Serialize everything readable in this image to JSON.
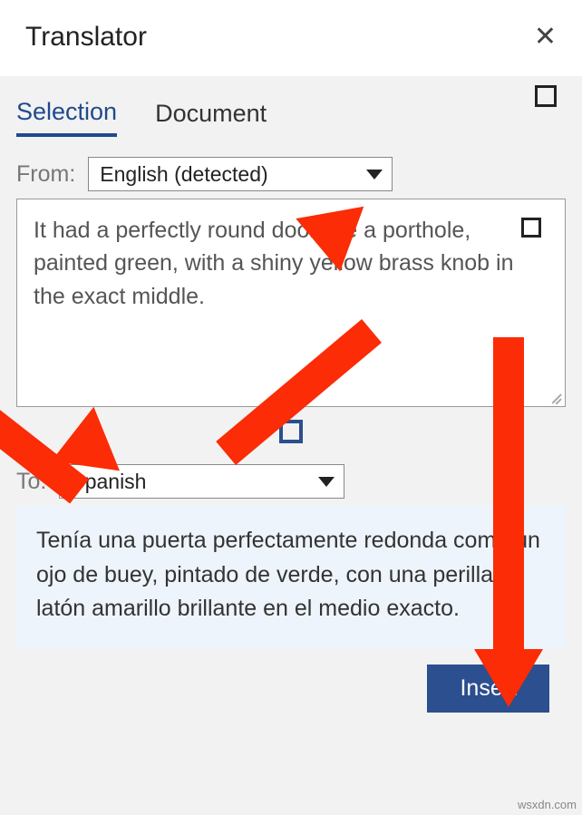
{
  "header": {
    "title": "Translator"
  },
  "tabs": {
    "selection": "Selection",
    "document": "Document",
    "active": "selection"
  },
  "from": {
    "label": "From:",
    "selected": "English (detected)"
  },
  "source_text": "It had a perfectly round door like a porthole, painted green, with a shiny yellow brass knob in the exact middle.",
  "to": {
    "label": "To:",
    "selected": "Spanish"
  },
  "output_text": "Tenía una puerta perfectamente redonda como un ojo de buey, pintado de verde, con una perilla de latón amarillo brillante en el medio exacto.",
  "buttons": {
    "insert": "Insert"
  },
  "watermark": "wsxdn.com",
  "colors": {
    "accent": "#2b4f8f",
    "arrow": "#fb2c06",
    "output_bg": "#eef4fb"
  }
}
